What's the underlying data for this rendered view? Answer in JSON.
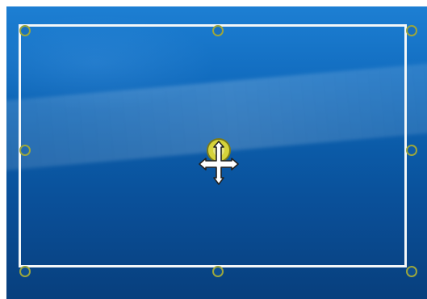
{
  "desktop_wallpaper": {
    "icon": "windows-desktop-wallpaper",
    "colors": {
      "top": "#1d7fd3",
      "middle": "#0b5ba8",
      "bottom": "#083f7d",
      "highlight": "#ffffff"
    }
  },
  "selection": {
    "frame_color": "#f4f7f8",
    "handle_color": "#9ba63d"
  },
  "rotation_handle": {
    "icon": "rotation-handle-icon",
    "color": "#d6d33b"
  },
  "cursor": {
    "icon": "move-cursor-icon",
    "color": "#ffffff"
  }
}
